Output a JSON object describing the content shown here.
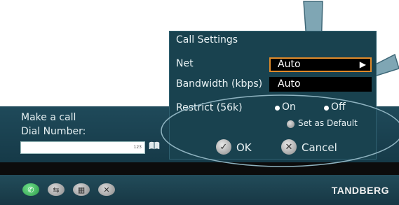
{
  "call": {
    "title": "Make a call",
    "dial_label": "Dial Number:",
    "dial_value": "",
    "input_mode": "123",
    "phonebook_icon": "phonebook-icon"
  },
  "dialog": {
    "title": "Call Settings",
    "net_label": "Net",
    "net_value": "Auto",
    "net_arrow": "▶",
    "bandwidth_label": "Bandwidth (kbps)",
    "bandwidth_value": "Auto",
    "restrict_label": "Restrict (56k)",
    "restrict_on": "On",
    "restrict_off": "Off",
    "restrict_selected": "Off",
    "set_default": "Set as Default",
    "ok_label": "OK",
    "cancel_label": "Cancel",
    "ok_icon": "check-icon",
    "cancel_icon": "x-icon"
  },
  "softkeys": [
    {
      "icon": "call-icon"
    },
    {
      "icon": "transfer-icon"
    },
    {
      "icon": "keyboard-icon"
    },
    {
      "icon": "close-icon"
    }
  ],
  "brand": "TANDBERG",
  "colors": {
    "panel": "#1f4a5a",
    "dialog": "#19424f",
    "focus_border": "#e08a2a",
    "annotation": "#7fa6b4",
    "call_button": "#2f9a4a"
  }
}
